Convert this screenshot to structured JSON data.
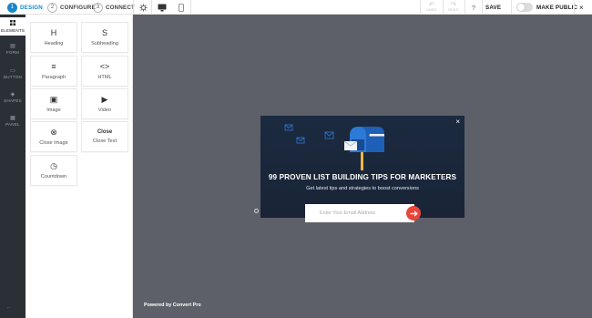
{
  "topbar": {
    "steps": [
      {
        "num": "1",
        "label": "DESIGN"
      },
      {
        "num": "2",
        "label": "CONFIGURE"
      },
      {
        "num": "3",
        "label": "CONNECT"
      }
    ],
    "undo_label": "UNDO",
    "redo_label": "REDO",
    "help": "?",
    "save_label": "SAVE",
    "make_public_label": "MAKE PUBLIC",
    "close": "×",
    "accent_color": "#1a87c9",
    "icons": [
      "settings-gear-icon",
      "desktop-icon",
      "mobile-icon",
      "undo-icon",
      "redo-icon"
    ]
  },
  "rail": {
    "items": [
      {
        "label": "ELEMENTS",
        "icon": "grid-icon"
      },
      {
        "label": "FORM",
        "icon": "form-icon"
      },
      {
        "label": "BUTTON",
        "icon": "button-icon"
      },
      {
        "label": "SHAPES",
        "icon": "shapes-icon"
      },
      {
        "label": "PANEL",
        "icon": "panel-icon"
      }
    ],
    "collapse_icon": "arrow-left-icon"
  },
  "elements": [
    {
      "glyph": "H",
      "label": "Heading"
    },
    {
      "glyph": "S",
      "label": "Subheading"
    },
    {
      "glyph": "≡",
      "label": "Paragraph"
    },
    {
      "glyph": "<>",
      "label": "HTML"
    },
    {
      "glyph": "▣",
      "label": "Image"
    },
    {
      "glyph": "▶",
      "label": "Video"
    },
    {
      "glyph": "⊗",
      "label": "Close Image"
    },
    {
      "glyph": "Close",
      "label": "Close Text"
    },
    {
      "glyph": "◷",
      "label": "Countdown"
    }
  ],
  "canvas": {
    "background": "#5d6068",
    "powered_by": "Powered by Convert Pro"
  },
  "popup": {
    "title": "99 PROVEN LIST BUILDING TIPS FOR MARKETERS",
    "subtitle": "Get latest tips and strategies to boost conversions",
    "email_placeholder": "Enter Your Email Address",
    "close": "×",
    "button_color": "#e7463b",
    "illustration": "mailbox-icon"
  }
}
